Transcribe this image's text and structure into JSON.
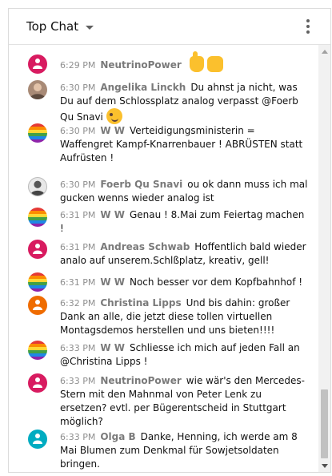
{
  "header": {
    "title": "Top Chat",
    "dropdown_icon": "caret-down-icon",
    "menu_icon": "more-vert-icon"
  },
  "colors": {
    "pink": "#d81b60",
    "orange": "#ef6c00",
    "teal": "#00acc1"
  },
  "messages": [
    {
      "time": "6:29 PM",
      "author": "NeutrinoPower",
      "text": "",
      "avatar": "pink",
      "emojis": [
        "thumbs-up-emoji",
        "raised-fist-emoji"
      ]
    },
    {
      "time": "6:30 PM",
      "author": "Angelika Linckh",
      "text": "Du ahnst ja nicht, was Du auf dem Schlossplatz analog verpasst @Foerb Qu Snavi",
      "avatar": "photo",
      "emojis": [
        "winking-face-emoji"
      ]
    },
    {
      "time": "6:30 PM",
      "author": "W W",
      "text": "Verteidigungsministerin = Waffengret Kampf-Knarrenbauer ! ABRÜSTEN statt Aufrüsten !",
      "avatar": "rainbow",
      "emojis": []
    },
    {
      "time": "6:30 PM",
      "author": "Foerb Qu Snavi",
      "text": "ou ok dann muss ich mal gucken wenns wieder analog ist",
      "avatar": "photo",
      "emojis": []
    },
    {
      "time": "6:31 PM",
      "author": "W W",
      "text": "Genau ! 8.Mai zum Feiertag machen !",
      "avatar": "rainbow",
      "emojis": []
    },
    {
      "time": "6:31 PM",
      "author": "Andreas Schwab",
      "text": "Hoffentlich bald wieder analo auf unserem.Schlßplatz, kreativ, gell!",
      "avatar": "pink",
      "emojis": []
    },
    {
      "time": "6:31 PM",
      "author": "W W",
      "text": "Noch besser vor dem Kopfbahnhof !",
      "avatar": "rainbow",
      "emojis": []
    },
    {
      "time": "6:32 PM",
      "author": "Christina Lipps",
      "text": "Und bis dahin: großer Dank an alle, die jetzt diese tollen virtuellen Montagsdemos herstellen und uns bieten!!!!",
      "avatar": "orange",
      "emojis": []
    },
    {
      "time": "6:33 PM",
      "author": "W W",
      "text": "Schliesse ich mich auf jeden Fall an @Christina Lipps !",
      "avatar": "rainbow",
      "emojis": []
    },
    {
      "time": "6:33 PM",
      "author": "NeutrinoPower",
      "text": "wie wär's den Mercedes-Stern mit den Mahnmal von Peter Lenk zu ersetzen? evtl. per Bügerentscheid in Stuttgart möglich?",
      "avatar": "pink",
      "emojis": []
    },
    {
      "time": "6:33 PM",
      "author": "Olga B",
      "text": "Danke, Henning, ich werde am 8 Mai Blumen zum Denkmal für Sowjetsoldaten bringen.",
      "avatar": "teal",
      "emojis": []
    }
  ]
}
